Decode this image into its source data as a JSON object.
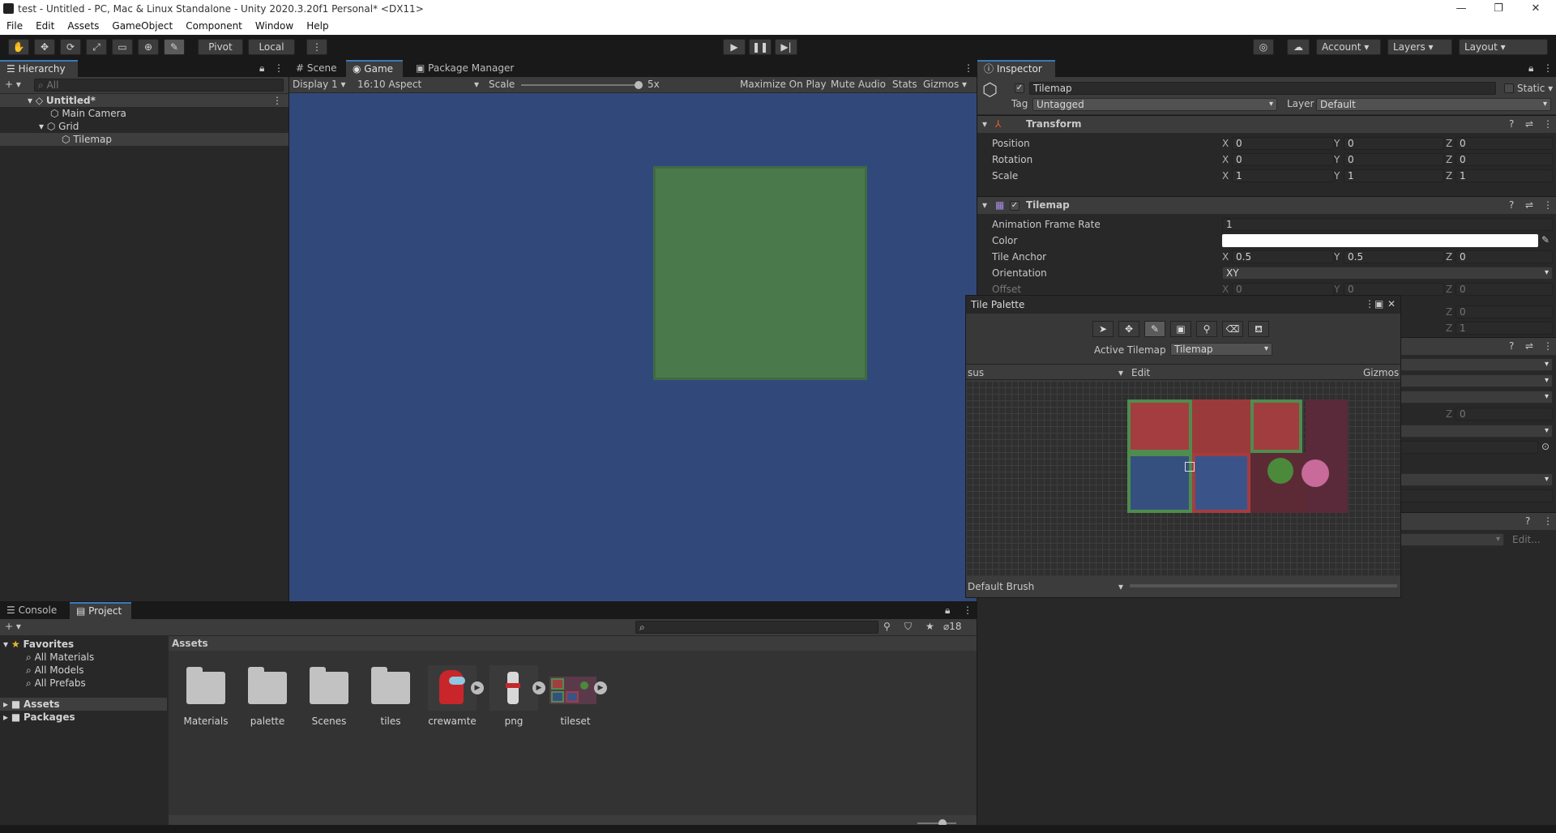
{
  "window": {
    "title": "test - Untitled - PC, Mac & Linux Standalone - Unity 2020.3.20f1 Personal* <DX11>",
    "minimize": "—",
    "maximize": "❐",
    "close": "✕"
  },
  "menu": [
    "File",
    "Edit",
    "Assets",
    "GameObject",
    "Component",
    "Window",
    "Help"
  ],
  "toolbar": {
    "pivot": "Pivot",
    "local": "Local",
    "account": "Account",
    "layers": "Layers",
    "layout": "Layout"
  },
  "hierarchy": {
    "tab": "Hierarchy",
    "search_placeholder": "All",
    "scene": "Untitled*",
    "items": [
      "Main Camera",
      "Grid",
      "Tilemap"
    ]
  },
  "view_tabs": [
    "Scene",
    "Game",
    "Package Manager"
  ],
  "game": {
    "display": "Display 1",
    "aspect": "16:10 Aspect",
    "scale_label": "Scale",
    "scale_value": "5x",
    "maximize": "Maximize On Play",
    "mute": "Mute Audio",
    "stats": "Stats",
    "gizmos": "Gizmos",
    "bg_color": "#31497a",
    "tile_color": "#4a7a4c"
  },
  "inspector": {
    "tab": "Inspector",
    "object_name": "Tilemap",
    "static": "Static",
    "tag_label": "Tag",
    "tag": "Untagged",
    "layer_label": "Layer",
    "layer": "Default",
    "transform": {
      "title": "Transform",
      "rows": [
        {
          "label": "Position",
          "x": "0",
          "y": "0",
          "z": "0"
        },
        {
          "label": "Rotation",
          "x": "0",
          "y": "0",
          "z": "0"
        },
        {
          "label": "Scale",
          "x": "1",
          "y": "1",
          "z": "1"
        }
      ]
    },
    "tilemap": {
      "title": "Tilemap",
      "anim_label": "Animation Frame Rate",
      "anim_value": "1",
      "color_label": "Color",
      "anchor_label": "Tile Anchor",
      "anchor_x": "0.5",
      "anchor_y": "0.5",
      "anchor_z": "0",
      "orientation_label": "Orientation",
      "orientation": "XY",
      "offset_label": "Offset",
      "offset_x": "0",
      "offset_y": "0",
      "offset_z": "0"
    },
    "hidden": {
      "z1": "0",
      "z2": "1",
      "z3": "0",
      "edit": "Edit..."
    },
    "axes": {
      "x": "X",
      "y": "Y",
      "z": "Z"
    }
  },
  "tile_palette": {
    "title": "Tile Palette",
    "active_label": "Active Tilemap",
    "active": "Tilemap",
    "palette": "sus",
    "edit": "Edit",
    "gizmos": "Gizmos",
    "brush": "Default Brush"
  },
  "bottom": {
    "tabs": [
      "Console",
      "Project"
    ],
    "count": "18"
  },
  "project": {
    "favorites": "Favorites",
    "fav_items": [
      "All Materials",
      "All Models",
      "All Prefabs"
    ],
    "roots": [
      "Assets",
      "Packages"
    ],
    "breadcrumb": "Assets",
    "assets": [
      "Materials",
      "palette",
      "Scenes",
      "tiles",
      "crewamte",
      "png",
      "tileset"
    ]
  }
}
